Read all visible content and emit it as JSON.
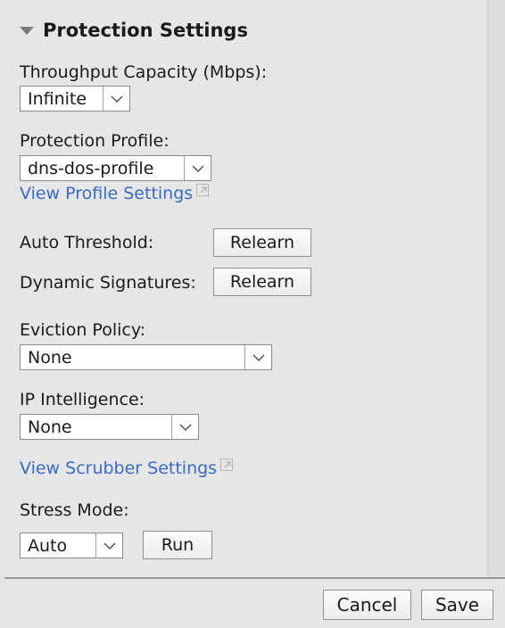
{
  "section": {
    "title": "Protection Settings"
  },
  "throughput": {
    "label": "Throughput Capacity (Mbps):",
    "value": "Infinite"
  },
  "profile": {
    "label": "Protection Profile:",
    "value": "dns-dos-profile",
    "view_link": "View Profile Settings"
  },
  "auto_threshold": {
    "label": "Auto Threshold:",
    "button": "Relearn"
  },
  "dynamic_signatures": {
    "label": "Dynamic Signatures:",
    "button": "Relearn"
  },
  "eviction": {
    "label": "Eviction Policy:",
    "value": "None"
  },
  "ip_intel": {
    "label": "IP Intelligence:",
    "value": "None"
  },
  "scrubber": {
    "view_link": "View Scrubber Settings"
  },
  "stress": {
    "label": "Stress Mode:",
    "value": "Auto",
    "run_button": "Run"
  },
  "footer": {
    "cancel": "Cancel",
    "save": "Save"
  },
  "colors": {
    "link": "#3a6bc4",
    "background": "#e6e6e6"
  }
}
